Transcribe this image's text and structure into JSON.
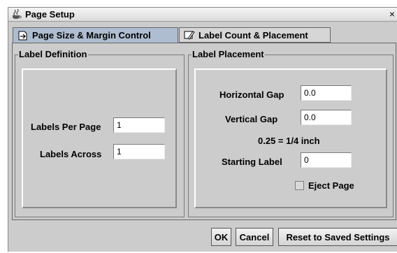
{
  "window": {
    "title": "Page Setup",
    "close_symbol": "×",
    "icon": "java-coffee-icon"
  },
  "tabs": [
    {
      "label": "Page Size & Margin Control",
      "icon": "page-arrow-icon",
      "selected": true
    },
    {
      "label": "Label Count & Placement",
      "icon": "pencil-page-icon",
      "selected": false
    }
  ],
  "label_definition": {
    "title": "Label Definition",
    "labels_per_page_label": "Labels Per Page",
    "labels_per_page_value": "1",
    "labels_across_label": "Labels Across",
    "labels_across_value": "1"
  },
  "label_placement": {
    "title": "Label Placement",
    "horizontal_gap_label": "Horizontal Gap",
    "horizontal_gap_value": "0.0",
    "vertical_gap_label": "Vertical Gap",
    "vertical_gap_value": "0.0",
    "hint": "0.25 = 1/4 inch",
    "starting_label_label": "Starting Label",
    "starting_label_value": "0",
    "eject_page_label": "Eject Page",
    "eject_page_checked": false
  },
  "buttons": {
    "ok": "OK",
    "cancel": "Cancel",
    "reset": "Reset to Saved Settings"
  },
  "colors": {
    "selected_tab": "#aebdcf",
    "dialog_bg": "#cccccc"
  }
}
